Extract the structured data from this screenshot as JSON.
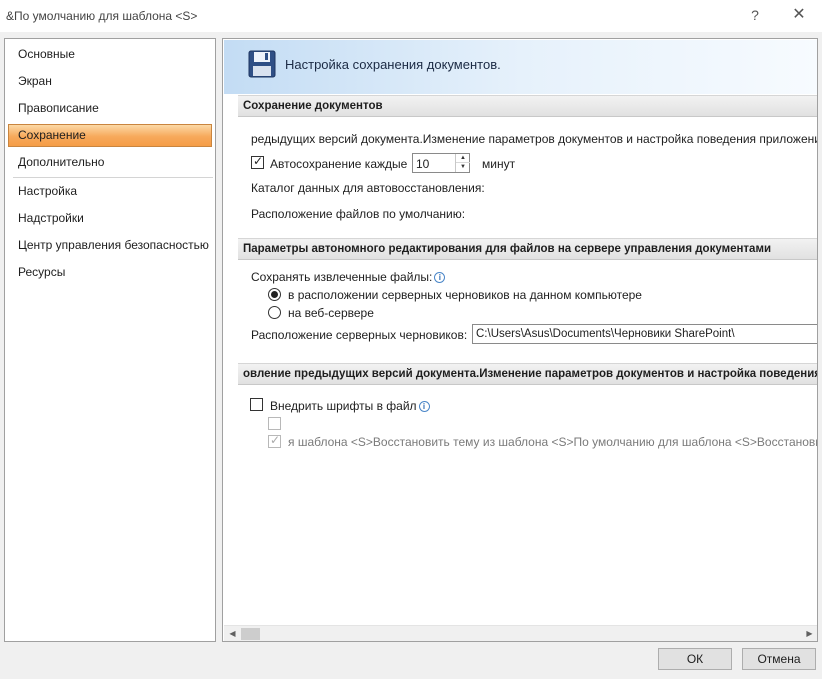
{
  "window": {
    "title": "&По умолчанию для шаблона <S>",
    "help_glyph": "?",
    "close_glyph": "✕"
  },
  "sidebar": {
    "items": [
      {
        "label": "Основные"
      },
      {
        "label": "Экран"
      },
      {
        "label": "Правописание"
      },
      {
        "label": "Сохранение",
        "selected": true
      },
      {
        "label": "Дополнительно"
      },
      {
        "label": "Настройка"
      },
      {
        "label": "Надстройки"
      },
      {
        "label": "Центр управления безопасностью"
      },
      {
        "label": "Ресурсы"
      }
    ]
  },
  "header": {
    "icon": "floppy-disk-icon",
    "title": "Настройка сохранения документов."
  },
  "save_section": {
    "title": "Сохранение документов",
    "description": "редыдущих версий документа.Изменение параметров документов и настройка поведения приложения.Восстановить тему из шаблона <S>",
    "autosave_label": "Автосохранение каждые",
    "autosave_checked": true,
    "autosave_value": "10",
    "autosave_unit": "минут",
    "autorecover_label": "Каталог данных для автовосстановления:",
    "default_location_label": "Расположение файлов по умолчанию:"
  },
  "offline_section": {
    "title": "Параметры автономного редактирования для файлов на сервере управления документами",
    "keep_files_label": "Сохранять извлеченные файлы:",
    "info_glyph": "i",
    "option_local": "в расположении серверных черновиков на данном компьютере",
    "option_local_selected": true,
    "option_web": "на веб-сервере",
    "option_web_selected": false,
    "drafts_location_label": "Расположение серверных черновиков:",
    "drafts_location_value": "C:\\Users\\Asus\\Documents\\Черновики SharePoint\\"
  },
  "fidelity_section": {
    "title": "овление предыдущих версий документа.Изменение параметров документов и настройка поведения приложения.",
    "embed_fonts_label": "Внедрить шрифты в файл",
    "embed_fonts_checked": false,
    "sub_option_1_label": "",
    "sub_option_1_checked": false,
    "sub_option_2_label": "я шаблона <S>Восстановить тему из шаблона <S>По умолчанию для шаблона <S>Восстановить :",
    "sub_option_2_checked": true
  },
  "scroll": {
    "left_glyph": "◀",
    "right_glyph": "▶"
  },
  "buttons": {
    "ok": "ОК",
    "cancel": "Отмена"
  },
  "colors": {
    "selected_item": "#f7a95b",
    "banner": "#c3dcf4",
    "info": "#2d6bb3"
  }
}
